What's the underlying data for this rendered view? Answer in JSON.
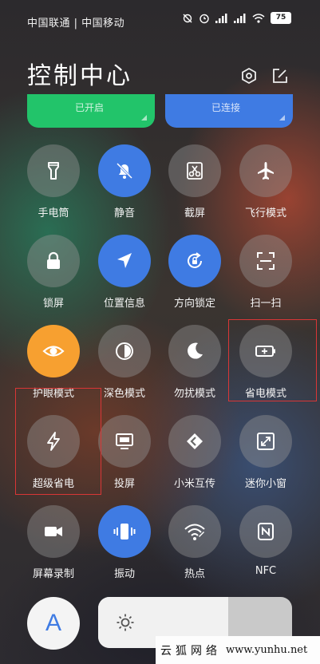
{
  "status_bar": {
    "carriers": "中国联通 | 中国移动",
    "battery": "75"
  },
  "header": {
    "title": "控制中心"
  },
  "top_tiles": {
    "mobile_data_status": "已开启",
    "wifi_status": "已连接"
  },
  "tiles": [
    {
      "label": "手电筒",
      "icon": "flashlight-icon",
      "state": "off"
    },
    {
      "label": "静音",
      "icon": "bell-off-icon",
      "state": "on"
    },
    {
      "label": "截屏",
      "icon": "scissors-icon",
      "state": "off"
    },
    {
      "label": "飞行模式",
      "icon": "airplane-icon",
      "state": "off"
    },
    {
      "label": "锁屏",
      "icon": "lock-icon",
      "state": "off"
    },
    {
      "label": "位置信息",
      "icon": "location-icon",
      "state": "on"
    },
    {
      "label": "方向锁定",
      "icon": "rotation-lock-icon",
      "state": "on"
    },
    {
      "label": "扫一扫",
      "icon": "scan-icon",
      "state": "off"
    },
    {
      "label": "护眼模式",
      "icon": "eye-icon",
      "state": "on-orange"
    },
    {
      "label": "深色模式",
      "icon": "dark-mode-icon",
      "state": "off"
    },
    {
      "label": "勿扰模式",
      "icon": "moon-icon",
      "state": "off"
    },
    {
      "label": "省电模式",
      "icon": "battery-saver-icon",
      "state": "off"
    },
    {
      "label": "超级省电",
      "icon": "lightning-icon",
      "state": "off"
    },
    {
      "label": "投屏",
      "icon": "cast-screen-icon",
      "state": "off"
    },
    {
      "label": "小米互传",
      "icon": "mi-share-icon",
      "state": "off"
    },
    {
      "label": "迷你小窗",
      "icon": "mini-window-icon",
      "state": "off"
    },
    {
      "label": "屏幕录制",
      "icon": "video-camera-icon",
      "state": "off"
    },
    {
      "label": "振动",
      "icon": "vibrate-icon",
      "state": "on"
    },
    {
      "label": "热点",
      "icon": "hotspot-icon",
      "state": "off"
    },
    {
      "label": "NFC",
      "icon": "nfc-icon",
      "state": "off"
    }
  ],
  "bottom": {
    "font_button_label": "A",
    "brightness_level": 0.67
  },
  "watermark": {
    "cn": "云狐网络",
    "url": "www.yunhu.net"
  },
  "colors": {
    "accent_blue": "#3f7be3",
    "accent_green": "#22c46a",
    "accent_orange": "#f7a030",
    "highlight_red": "#d93636"
  }
}
